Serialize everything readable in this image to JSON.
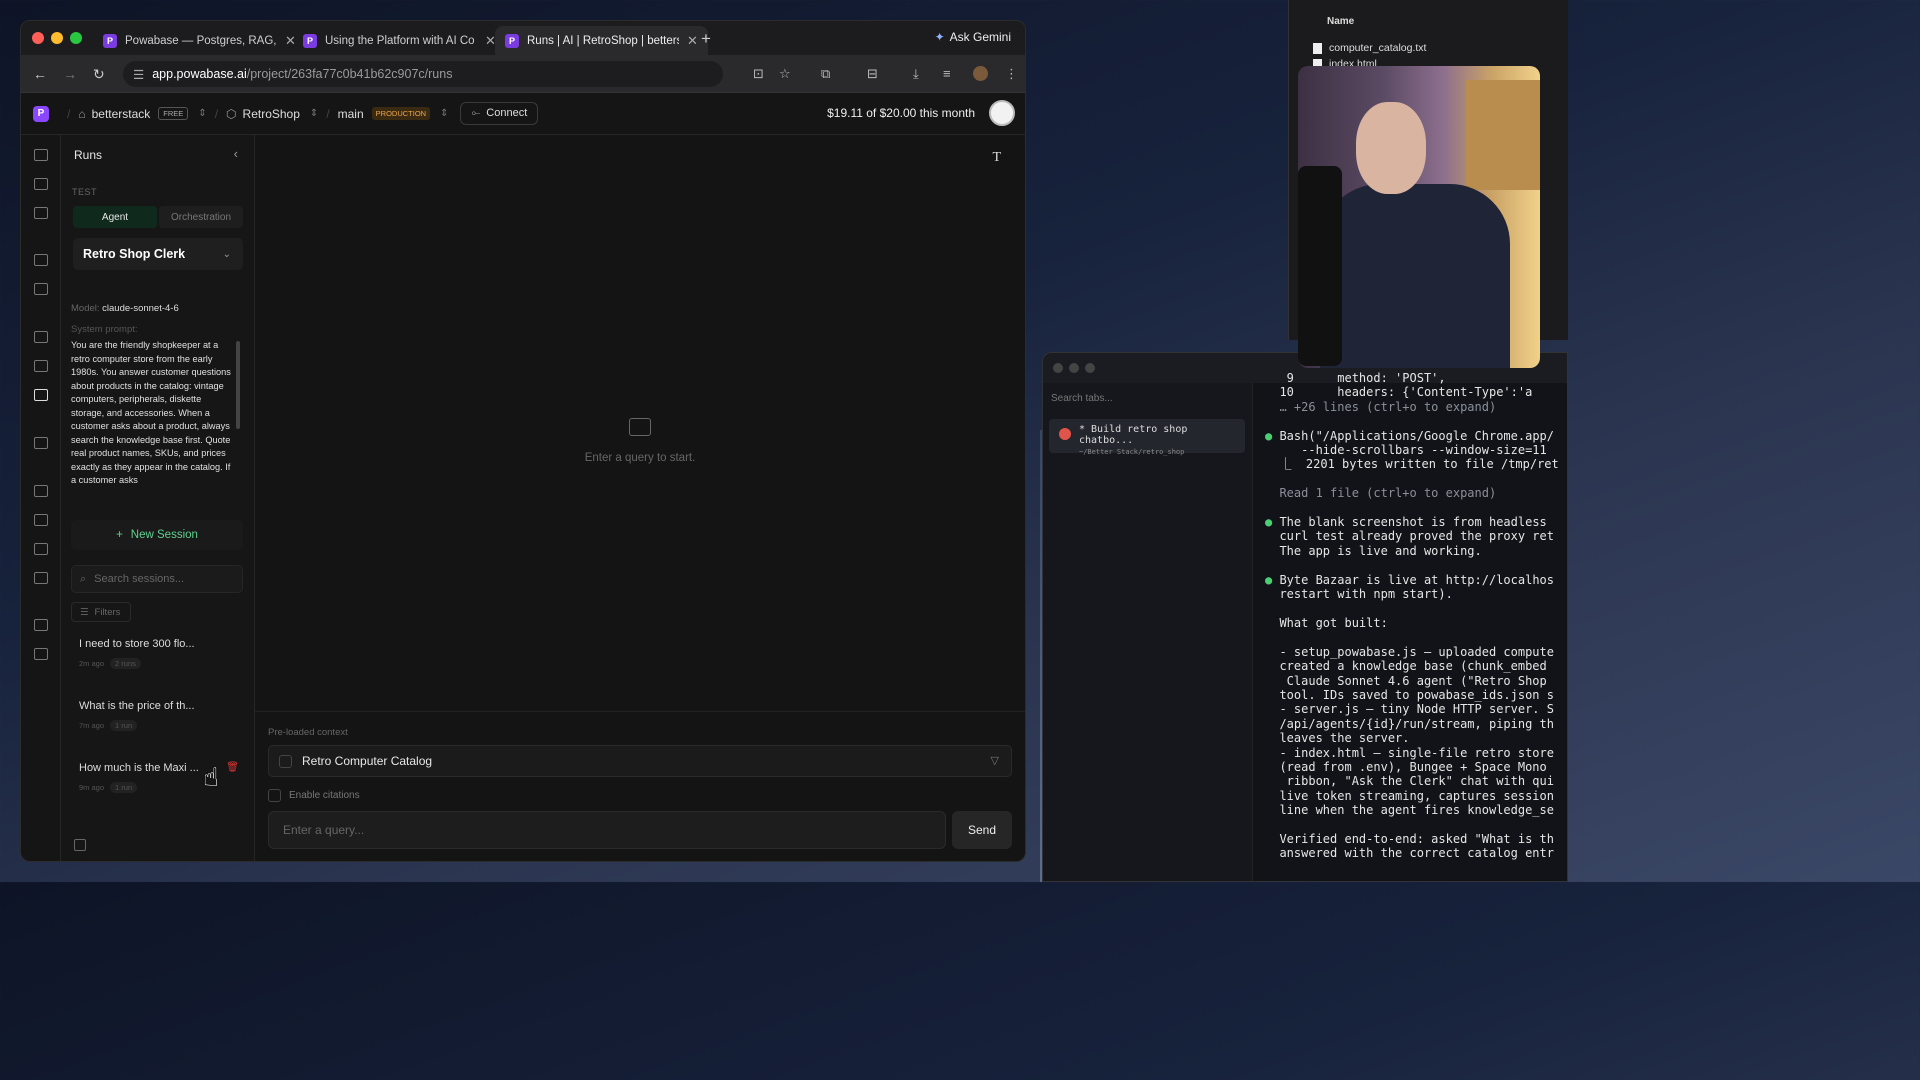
{
  "browser": {
    "tabs": [
      {
        "title": "Powabase — Postgres, RAG, a",
        "active": false
      },
      {
        "title": "Using the Platform with AI Co",
        "active": false
      },
      {
        "title": "Runs | AI | RetroShop | betters",
        "active": true
      }
    ],
    "ask_gemini": "Ask Gemini",
    "url_host": "app.powabase.ai",
    "url_path": "/project/263fa77c0b41b62c907c/runs"
  },
  "appbar": {
    "org": "betterstack",
    "org_badge": "FREE",
    "project": "RetroShop",
    "branch": "main",
    "branch_badge": "PRODUCTION",
    "connect": "Connect",
    "spend": "$19.11 of $20.00 this month"
  },
  "runs": {
    "title": "Runs",
    "section": "TEST",
    "mode_agent": "Agent",
    "mode_orchestration": "Orchestration",
    "agent_name": "Retro Shop Clerk",
    "model_label": "Model:",
    "model_value": "claude-sonnet-4-6",
    "system_prompt_label": "System prompt:",
    "system_prompt": "You are the friendly shopkeeper at a retro computer store from the early 1980s. You answer customer questions about products in the catalog: vintage computers, peripherals, diskette storage, and accessories. When a customer asks about a product, always search the knowledge base first. Quote real product names, SKUs, and prices exactly as they appear in the catalog. If a customer asks",
    "new_session": "New Session",
    "search_placeholder": "Search sessions...",
    "filters": "Filters",
    "sessions": [
      {
        "query": "I need to store 300 flo...",
        "age": "2m ago",
        "runs": "2 runs"
      },
      {
        "query": "What is the price of th...",
        "age": "7m ago",
        "runs": "1 run"
      },
      {
        "query": "How much is the Maxi ...",
        "age": "9m ago",
        "runs": "1 run"
      }
    ]
  },
  "main": {
    "empty_text": "Enter a query to start.",
    "context_label": "Pre-loaded context",
    "context_item": "Retro Computer Catalog",
    "citations_label": "Enable citations",
    "query_placeholder": "Enter a query...",
    "send": "Send"
  },
  "finder": {
    "header": "Name",
    "files": [
      "computer_catalog.txt",
      "index.html"
    ]
  },
  "terminal": {
    "search_placeholder": "Search tabs...",
    "session_title": "* Build retro shop chatbo...",
    "session_path": "~/Better Stack/retro_shop",
    "lines": [
      "   9      method: 'POST',",
      "  10      headers: {'Content-Type':'a",
      "  … +26 lines (ctrl+o to expand)",
      "",
      "● Bash(\"/Applications/Google Chrome.app/",
      "     --hide-scrollbars --window-size=11",
      "  ⎿  2201 bytes written to file /tmp/ret",
      "",
      "  Read 1 file (ctrl+o to expand)",
      "",
      "● The blank screenshot is from headless",
      "  curl test already proved the proxy ret",
      "  The app is live and working.",
      "",
      "● Byte Bazaar is live at http://localhos",
      "  restart with npm start).",
      "",
      "  What got built:",
      "",
      "  - setup_powabase.js — uploaded compute",
      "  created a knowledge base (chunk_embed",
      "   Claude Sonnet 4.6 agent (\"Retro Shop",
      "  tool. IDs saved to powabase_ids.json s",
      "  - server.js — tiny Node HTTP server. S",
      "  /api/agents/{id}/run/stream, piping th",
      "  leaves the server.",
      "  - index.html — single-file retro store",
      "  (read from .env), Bungee + Space Mono",
      "   ribbon, \"Ask the Clerk\" chat with qui",
      "  live token streaming, captures session",
      "  line when the agent fires knowledge_se",
      "",
      "  Verified end-to-end: asked \"What is th",
      "  answered with the correct catalog entr"
    ]
  }
}
